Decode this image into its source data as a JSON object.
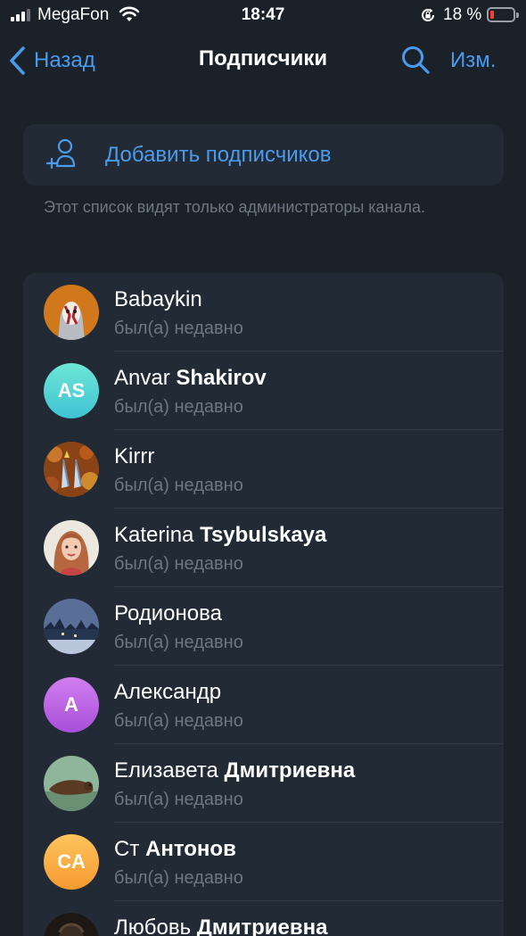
{
  "status_bar": {
    "carrier": "MegaFon",
    "time": "18:47",
    "battery": "18 %",
    "battery_level": 0.18
  },
  "nav": {
    "back": "Назад",
    "title": "Подписчики",
    "edit": "Изм."
  },
  "add": {
    "label": "Добавить подписчиков",
    "note": "Этот список видят только администраторы канала."
  },
  "subscribers": [
    {
      "first": "Babaykin",
      "last": "",
      "status": "был(а) недавно",
      "avatar_type": "photo-mask",
      "avatar_color": "#d2781c"
    },
    {
      "first": "Anvar",
      "last": "Shakirov",
      "status": "был(а) недавно",
      "avatar_type": "initials",
      "initials": "AS",
      "avatar_color": "#4fd5d0"
    },
    {
      "first": "Kirrr",
      "last": "",
      "status": "был(а) недавно",
      "avatar_type": "photo-leaves",
      "avatar_color": "#a8551d"
    },
    {
      "first": "Katerina",
      "last": "Tsybulskaya",
      "status": "был(а) недавно",
      "avatar_type": "photo-portrait",
      "avatar_color": "#e8e3d8"
    },
    {
      "first": "Родионова",
      "last": "",
      "status": "был(а) недавно",
      "avatar_type": "photo-winter",
      "avatar_color": "#3a5075"
    },
    {
      "first": "Александр",
      "last": "",
      "status": "был(а) недавно",
      "avatar_type": "initials",
      "initials": "A",
      "avatar_color": "#b45ee0"
    },
    {
      "first": "Елизавета",
      "last": "Дмитриевна",
      "status": "был(а) недавно",
      "avatar_type": "photo-animal",
      "avatar_color": "#7fa487"
    },
    {
      "first": "Ст",
      "last": "Антонов",
      "status": "был(а) недавно",
      "avatar_type": "initials",
      "initials": "CA",
      "avatar_color": "#f5a442"
    },
    {
      "first": "Любовь",
      "last": "Дмитриевна",
      "status": "",
      "avatar_type": "photo-dark",
      "avatar_color": "#2c2520"
    }
  ]
}
